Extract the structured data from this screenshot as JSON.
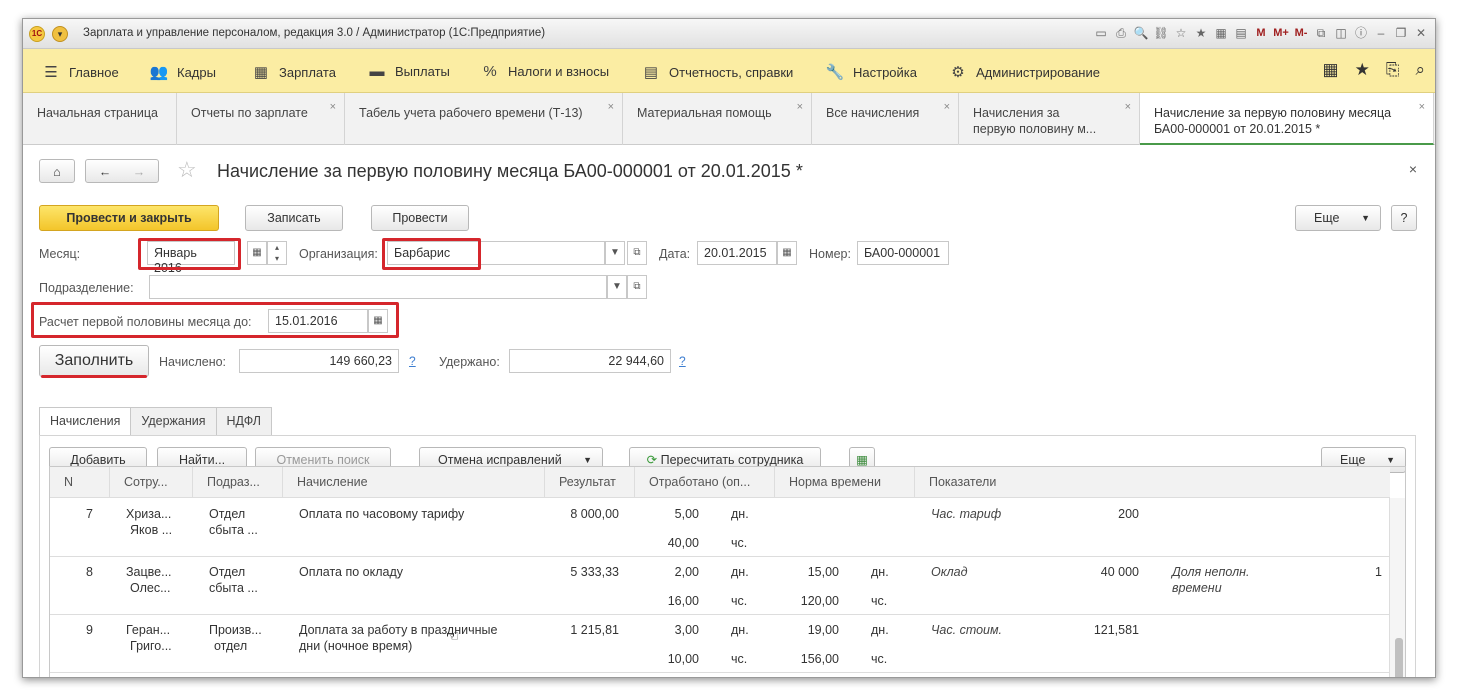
{
  "window": {
    "title": "Зарплата и управление персоналом, редакция 3.0 / Администратор  (1С:Предприятие)",
    "logo": "1С",
    "toolbar_m": [
      "M",
      "M+",
      "M-"
    ]
  },
  "menu": [
    {
      "label": "Главное",
      "icon": "hamburger-icon"
    },
    {
      "label": "Кадры",
      "icon": "people-icon"
    },
    {
      "label": "Зарплата",
      "icon": "calculator-icon"
    },
    {
      "label": "Выплаты",
      "icon": "wallet-icon"
    },
    {
      "label": "Налоги и взносы",
      "icon": "percent-icon"
    },
    {
      "label": "Отчетность, справки",
      "icon": "report-icon"
    },
    {
      "label": "Настройка",
      "icon": "wrench-icon"
    },
    {
      "label": "Администрирование",
      "icon": "gear-icon"
    }
  ],
  "tabs": [
    {
      "label": "Начальная страница"
    },
    {
      "label": "Отчеты по зарплате"
    },
    {
      "label": "Табель учета рабочего времени (Т-13)"
    },
    {
      "label": "Материальная помощь"
    },
    {
      "label": "Все начисления"
    },
    {
      "label1": "Начисления за",
      "label2": "первую половину м..."
    },
    {
      "label1": "Начисление за первую половину месяца",
      "label2": "БА00-000001 от 20.01.2015 *"
    }
  ],
  "doc": {
    "title": "Начисление за первую половину месяца БА00-000001 от 20.01.2015 *",
    "btn_post_close": "Провести и закрыть",
    "btn_save": "Записать",
    "btn_post": "Провести",
    "btn_more": "Еще",
    "btn_help": "?",
    "month_label": "Месяц:",
    "month_value": "Январь 2016",
    "org_label": "Организация:",
    "org_value": "Барбарис",
    "date_label": "Дата:",
    "date_value": "20.01.2015",
    "number_label": "Номер:",
    "number_value": "БА00-000001",
    "dept_label": "Подразделение:",
    "dept_value": "",
    "calc_label": "Расчет первой половины месяца до:",
    "calc_value": "15.01.2016",
    "btn_fill": "Заполнить",
    "accrued_label": "Начислено:",
    "accrued_value": "149 660,23",
    "withheld_label": "Удержано:",
    "withheld_value": "22 944,60",
    "q": "?"
  },
  "inner_tabs": [
    "Начисления",
    "Удержания",
    "НДФЛ"
  ],
  "grid_toolbar": {
    "add": "Добавить",
    "find": "Найти...",
    "cancel_search": "Отменить поиск",
    "cancel_fix": "Отмена исправлений",
    "recalc": "Пересчитать сотрудника",
    "more": "Еще"
  },
  "columns": [
    "N",
    "Сотру...",
    "Подраз...",
    "Начисление",
    "Результат",
    "Отработано (оп...",
    "Норма времени",
    "Показатели"
  ],
  "rows": [
    {
      "n": "7",
      "emp1": "Хриза...",
      "emp2": "Яков ...",
      "dep1": "Отдел",
      "dep2": "сбыта ...",
      "accrual1": "Оплата по часовому тарифу",
      "accrual2": "",
      "result": "8 000,00",
      "worked1": "5,00",
      "wu1": "дн.",
      "worked2": "40,00",
      "wu2": "чс.",
      "norm1": "",
      "nu1": "",
      "norm2": "",
      "nu2": "",
      "ind1_name": "Час. тариф",
      "ind1_val": "200",
      "ind2_name1": "",
      "ind2_name2": "",
      "ind2_val": ""
    },
    {
      "n": "8",
      "emp1": "Зацве...",
      "emp2": "Олес...",
      "dep1": "Отдел",
      "dep2": "сбыта ...",
      "accrual1": "Оплата по окладу",
      "accrual2": "",
      "result": "5 333,33",
      "worked1": "2,00",
      "wu1": "дн.",
      "worked2": "16,00",
      "wu2": "чс.",
      "norm1": "15,00",
      "nu1": "дн.",
      "norm2": "120,00",
      "nu2": "чс.",
      "ind1_name": "Оклад",
      "ind1_val": "40 000",
      "ind2_name1": "Доля неполн.",
      "ind2_name2": "времени",
      "ind2_val": "1"
    },
    {
      "n": "9",
      "emp1": "Геран...",
      "emp2": "Григо...",
      "dep1": "Произв...",
      "dep2": "отдел",
      "accrual1": "Доплата за работу в праздничные",
      "accrual2": "дни (ночное время)",
      "result": "1 215,81",
      "worked1": "3,00",
      "wu1": "дн.",
      "worked2": "10,00",
      "wu2": "чс.",
      "norm1": "19,00",
      "nu1": "дн.",
      "norm2": "156,00",
      "nu2": "чс.",
      "ind1_name": "Час. стоим.",
      "ind1_val": "121,581",
      "ind2_name1": "",
      "ind2_name2": "",
      "ind2_val": ""
    }
  ]
}
